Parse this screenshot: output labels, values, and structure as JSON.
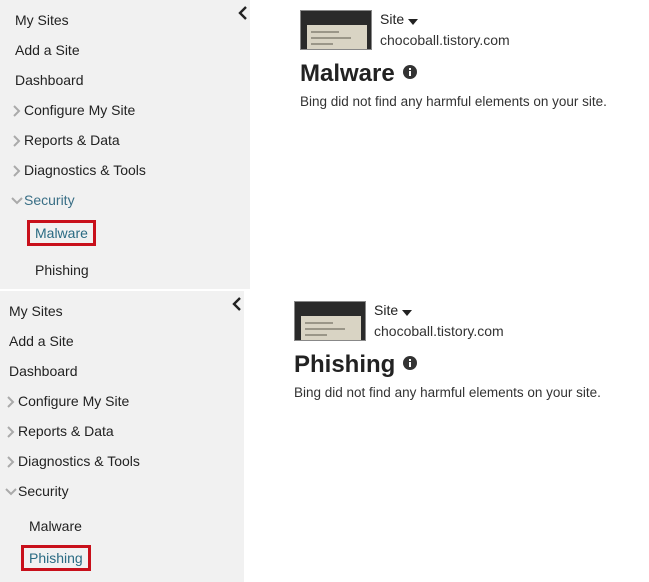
{
  "panels": [
    {
      "sidebar": {
        "items": [
          {
            "label": "My Sites"
          },
          {
            "label": "Add a Site"
          },
          {
            "label": "Dashboard"
          },
          {
            "label": "Configure My Site",
            "icon": "chevron-right-icon"
          },
          {
            "label": "Reports & Data",
            "icon": "chevron-right-icon"
          },
          {
            "label": "Diagnostics & Tools",
            "icon": "chevron-right-icon"
          },
          {
            "label": "Security",
            "icon": "chevron-down-icon"
          }
        ],
        "sub_items": [
          {
            "label": "Malware",
            "active": true
          },
          {
            "label": "Phishing",
            "active": false
          }
        ],
        "collapse_icon": "chevron-left-icon"
      },
      "content": {
        "site_selector": "Site",
        "site_url": "chocoball.tistory.com",
        "title": "Malware",
        "info_icon": "info-icon",
        "description": "Bing did not find any harmful elements on your site."
      }
    },
    {
      "sidebar": {
        "items": [
          {
            "label": "My Sites"
          },
          {
            "label": "Add a Site"
          },
          {
            "label": "Dashboard"
          },
          {
            "label": "Configure My Site",
            "icon": "chevron-right-icon"
          },
          {
            "label": "Reports & Data",
            "icon": "chevron-right-icon"
          },
          {
            "label": "Diagnostics & Tools",
            "icon": "chevron-right-icon"
          },
          {
            "label": "Security",
            "icon": "chevron-down-icon"
          }
        ],
        "sub_items": [
          {
            "label": "Malware",
            "active": false
          },
          {
            "label": "Phishing",
            "active": true
          }
        ],
        "collapse_icon": "chevron-left-icon"
      },
      "content": {
        "site_selector": "Site",
        "site_url": "chocoball.tistory.com",
        "title": "Phishing",
        "info_icon": "info-icon",
        "description": "Bing did not find any harmful elements on your site."
      }
    }
  ],
  "colors": {
    "sidebar_bg": "#f1f1f1",
    "active_border": "#c8101b",
    "active_text": "#2a6b83"
  }
}
